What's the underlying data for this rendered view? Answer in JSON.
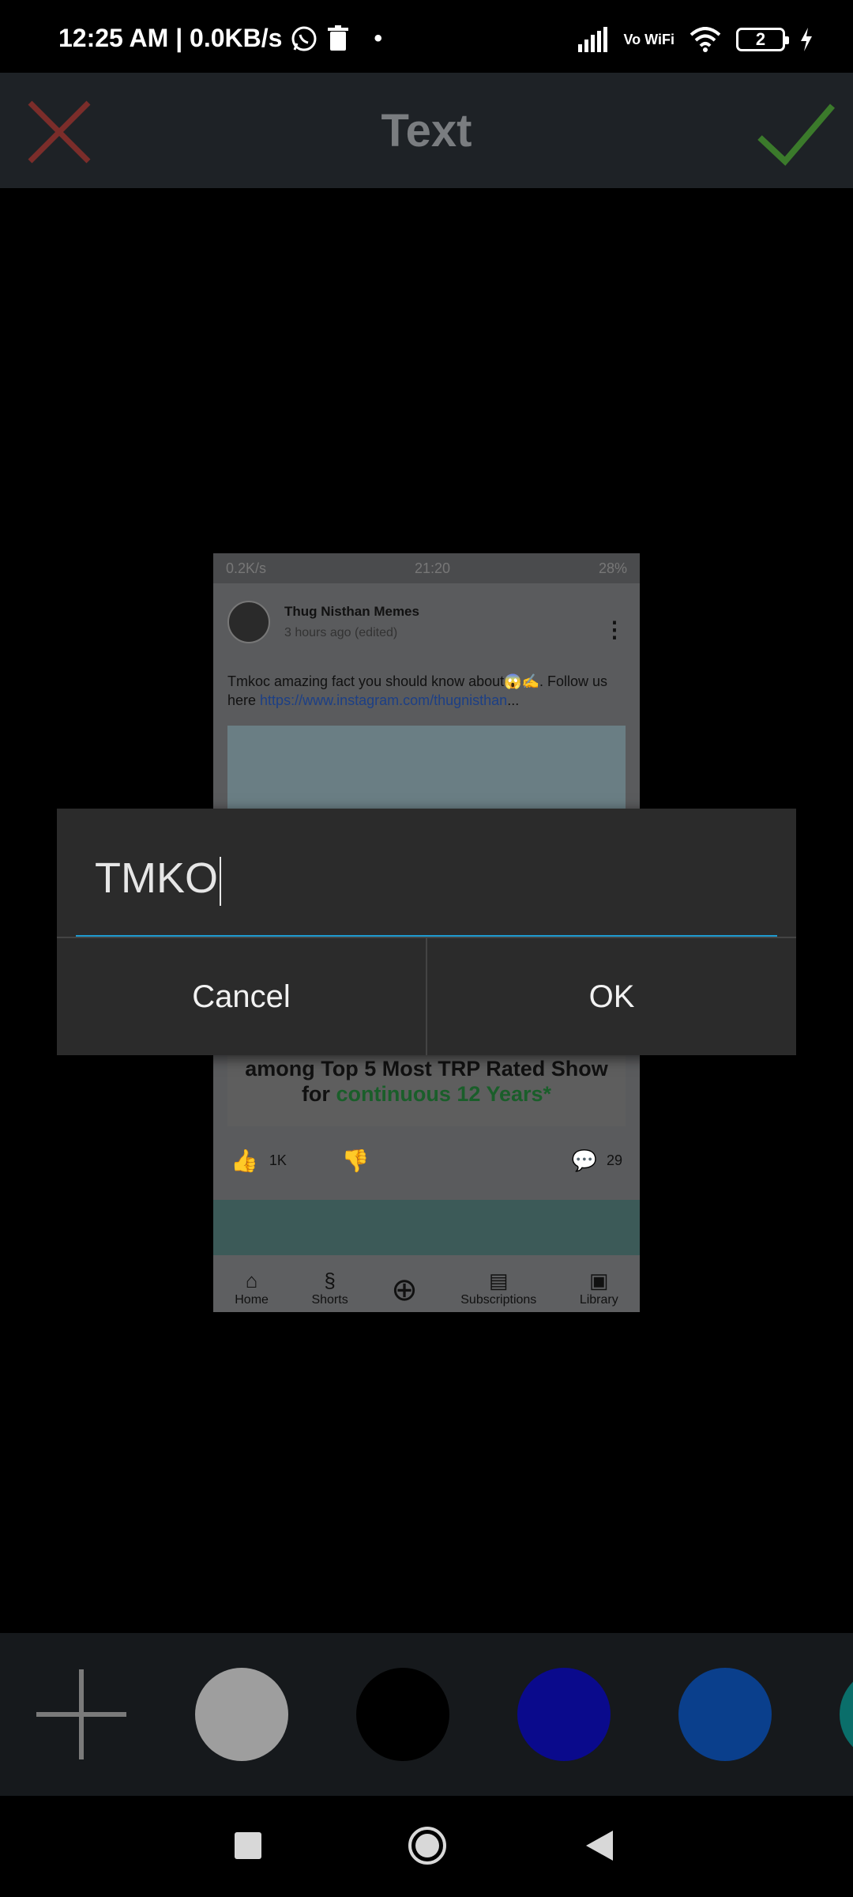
{
  "status_bar": {
    "time_speed": "12:25 AM | 0.0KB/s",
    "network_label": "Vo WiFi",
    "battery": "2"
  },
  "toolbar": {
    "title": "Text",
    "close_icon": "close-x-icon",
    "confirm_icon": "checkmark-icon",
    "close_color": "#7b2d2a",
    "confirm_color": "#3b7a2b"
  },
  "canvas_image": {
    "status_time": "21:20",
    "status_left": "0.2K/s",
    "status_right": "28%",
    "post": {
      "channel_name": "Thug Nisthan Memes",
      "time_label": "3 hours ago (edited)",
      "text": "Tmkoc amazing fact you should know about😱✍. Follow us here",
      "link": "https://www.instagram.com/thugnisthan",
      "ellipsis": "...",
      "image_caption_line1": "among Top 5 Most TRP Rated Show",
      "image_caption_line2_prefix": "for ",
      "image_caption_line2_highlight": "continuous 12 Years*",
      "likes": "1K",
      "comments": "29"
    },
    "bottom_nav": [
      "Home",
      "Shorts",
      "",
      "Subscriptions",
      "Library"
    ]
  },
  "dialog": {
    "input_value": "TMKO",
    "cancel_label": "Cancel",
    "ok_label": "OK",
    "accent_color": "#1e9bd0"
  },
  "palette": {
    "add_icon": "plus-icon",
    "colors": [
      "#9e9e9e",
      "#000000",
      "#0a0a8c",
      "#0a3f8c",
      "#0a6e6a"
    ]
  }
}
